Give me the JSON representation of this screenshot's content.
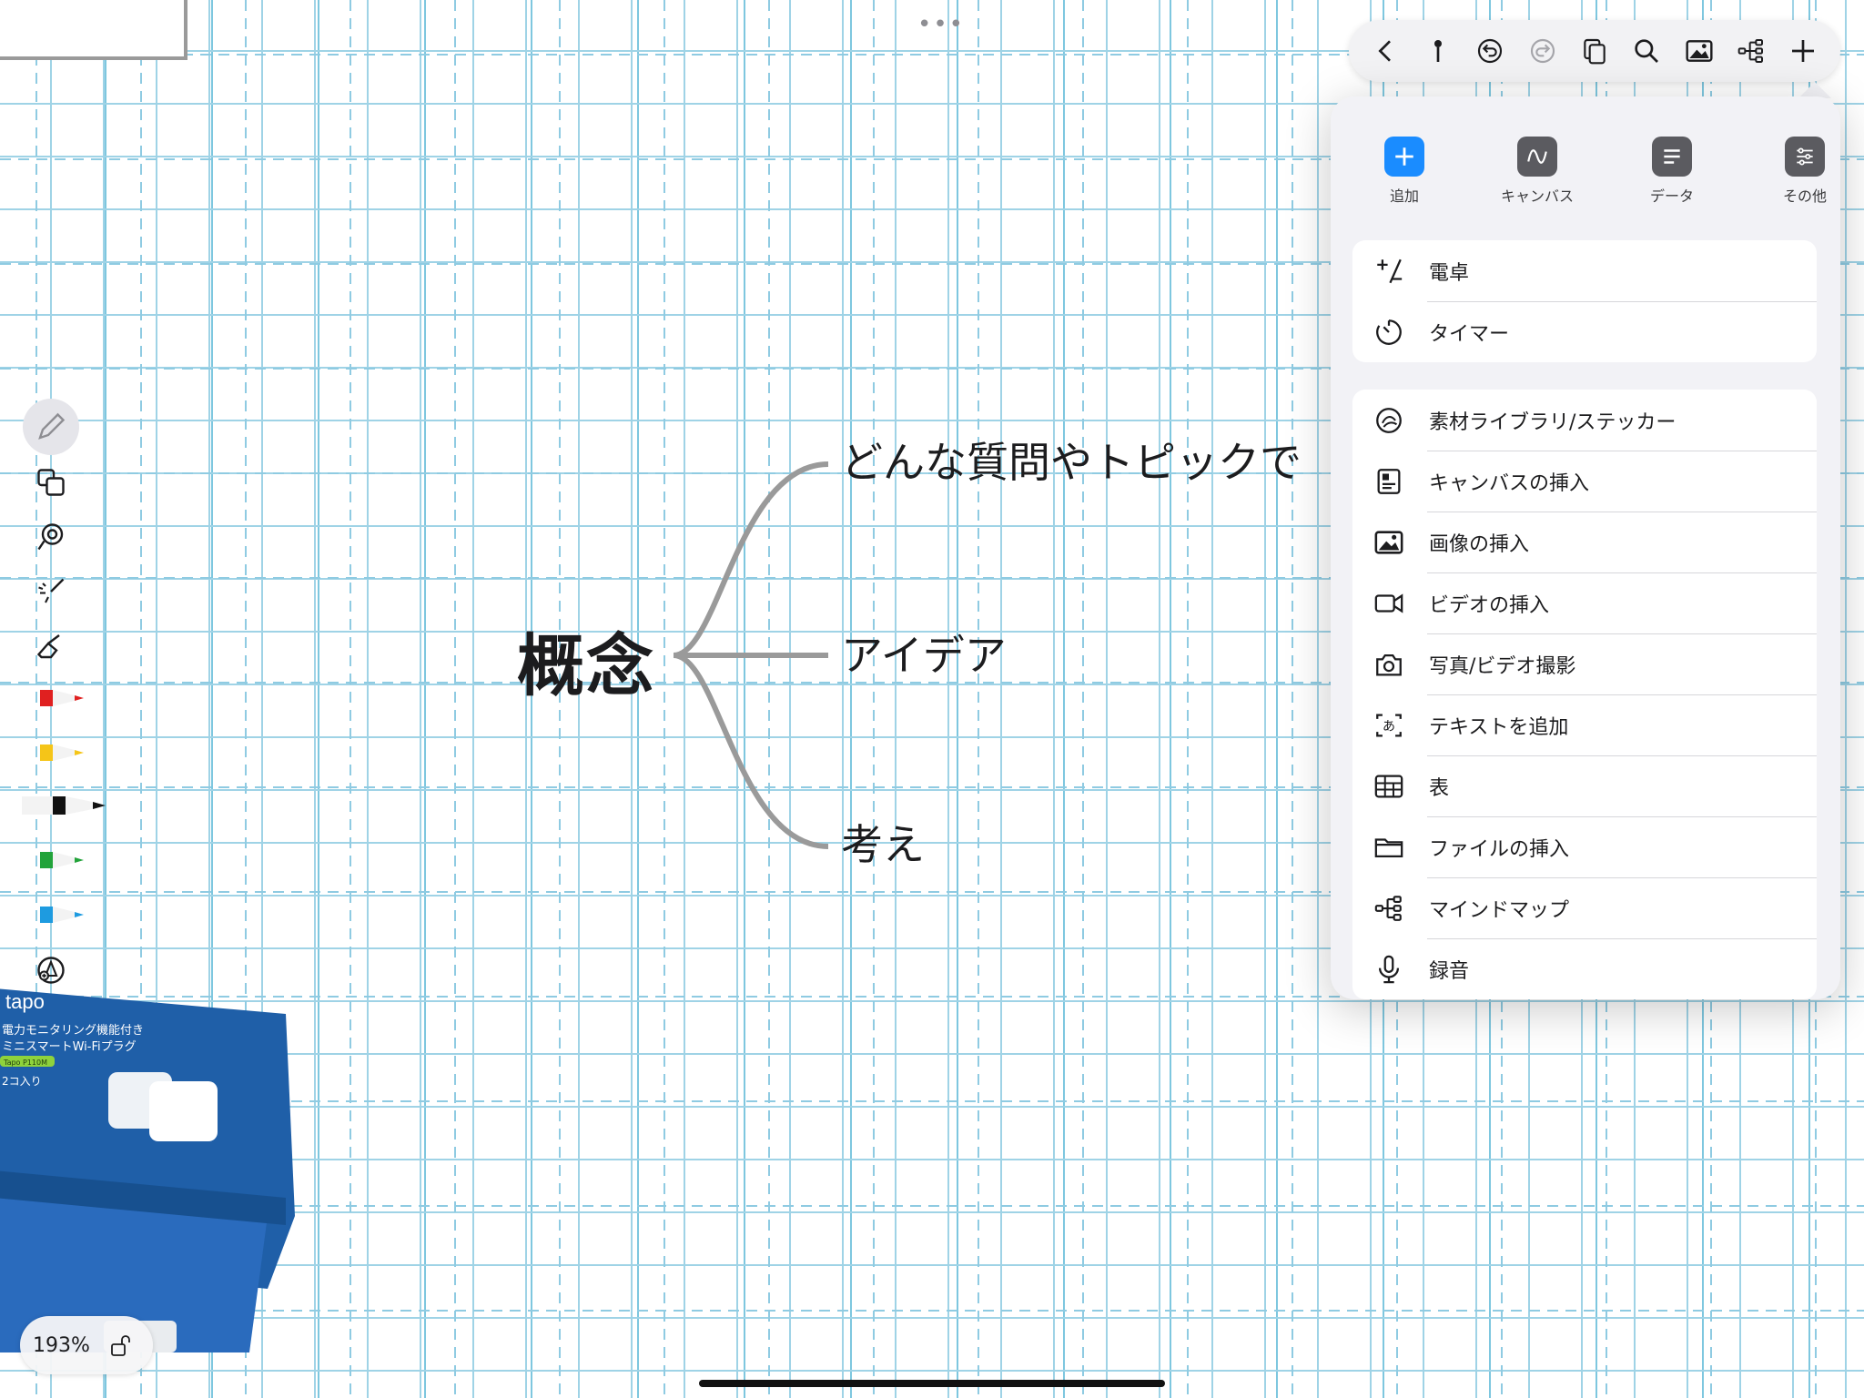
{
  "toolbar": {
    "items": [
      "back-icon",
      "pin-icon",
      "undo-icon",
      "redo-icon",
      "pages-icon",
      "search-icon",
      "image-icon",
      "mindmap-icon",
      "plus-icon"
    ]
  },
  "popover": {
    "tabs": [
      {
        "label": "追加",
        "icon": "plus-icon"
      },
      {
        "label": "キャンバス",
        "icon": "wave-icon"
      },
      {
        "label": "データ",
        "icon": "lines-icon"
      },
      {
        "label": "その他",
        "icon": "sliders-icon"
      }
    ],
    "group1": [
      {
        "label": "電卓",
        "icon": "plus-minus-icon"
      },
      {
        "label": "タイマー",
        "icon": "timer-icon"
      }
    ],
    "group2": [
      {
        "label": "素材ライブラリ/ステッカー",
        "icon": "sticker-icon"
      },
      {
        "label": "キャンバスの挿入",
        "icon": "canvas-doc-icon"
      },
      {
        "label": "画像の挿入",
        "icon": "image-icon"
      },
      {
        "label": "ビデオの挿入",
        "icon": "video-icon"
      },
      {
        "label": "写真/ビデオ撮影",
        "icon": "camera-icon"
      },
      {
        "label": "テキストを追加",
        "icon": "text-box-icon"
      },
      {
        "label": "表",
        "icon": "table-icon"
      },
      {
        "label": "ファイルの挿入",
        "icon": "folder-icon"
      },
      {
        "label": "マインドマップ",
        "icon": "mindmap-icon"
      },
      {
        "label": "録音",
        "icon": "microphone-icon"
      }
    ]
  },
  "mindmap": {
    "root": "概念",
    "children": [
      "どんな質問やトピックで",
      "アイデア",
      "考え"
    ]
  },
  "tools": {
    "pen_colors": [
      "#e02020",
      "#f5c518",
      "#111111",
      "#22a33a",
      "#1e9be0"
    ]
  },
  "photo": {
    "brand": "tapo",
    "line1": "電力モニタリング機能付き",
    "line2": "ミニスマートWi-Fiプラグ",
    "model": "Tapo P110M",
    "count": "2コ入り"
  },
  "status": {
    "zoom": "193%"
  }
}
